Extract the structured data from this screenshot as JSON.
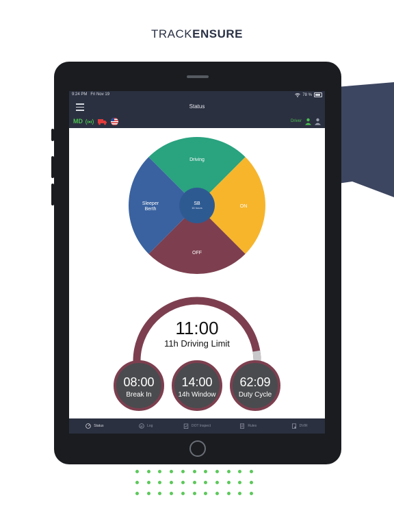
{
  "brand": {
    "prefix": "TRACK",
    "suffix": "ENSURE"
  },
  "statusbar": {
    "time": "9:24 PM",
    "date": "Fri Nov 19",
    "battery": "78 %"
  },
  "navbar": {
    "title": "Status"
  },
  "infobar": {
    "jurisdiction": "MD",
    "role": "Driver"
  },
  "wheel": {
    "driving": "Driving",
    "on_duty": "ON",
    "off_duty": "OFF",
    "sleeper_line1": "Sleeper",
    "sleeper_line2": "Berth",
    "center_label": "SB",
    "center_sub": "16 hours"
  },
  "timers": {
    "main_value": "11:00",
    "main_label": "11h Driving Limit",
    "break_value": "08:00",
    "break_label": "Break In",
    "window_value": "14:00",
    "window_label": "14h Window",
    "cycle_value": "62:09",
    "cycle_label": "Duty Cycle"
  },
  "tabs": [
    {
      "label": "Status",
      "icon": "speedometer-icon"
    },
    {
      "label": "Log",
      "icon": "log-icon"
    },
    {
      "label": "DOT Inspect",
      "icon": "clipboard-icon"
    },
    {
      "label": "Rules",
      "icon": "document-icon"
    },
    {
      "label": "DVIR",
      "icon": "report-icon"
    }
  ],
  "colors": {
    "driving": "#2aa37f",
    "on_duty": "#f7b52c",
    "off_duty": "#7d3f4f",
    "sleeper": "#3a62a0",
    "center": "#2e5a92",
    "arc": "#7d3f4f",
    "timer_fill": "#4a4b4e",
    "nav_bg": "#2b3040",
    "accent_green": "#4cc152"
  }
}
